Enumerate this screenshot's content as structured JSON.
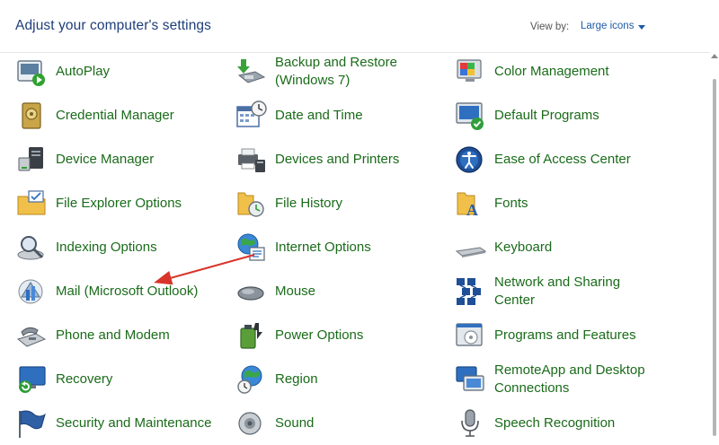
{
  "header": {
    "title": "Adjust your computer's settings",
    "view_by_label": "View by:",
    "view_by_value": "Large icons"
  },
  "colors": {
    "link_green": "#1a6b1a",
    "title_blue": "#1e3e7a",
    "accent_blue": "#1e5aa8",
    "annotation_red": "#d9342b"
  },
  "items": [
    {
      "label": "AutoPlay",
      "icon": "autoplay-icon"
    },
    {
      "label": "Backup and Restore\n(Windows 7)",
      "icon": "backup-restore-icon"
    },
    {
      "label": "Color Management",
      "icon": "color-management-icon"
    },
    {
      "label": "Credential Manager",
      "icon": "credential-manager-icon"
    },
    {
      "label": "Date and Time",
      "icon": "date-time-icon"
    },
    {
      "label": "Default Programs",
      "icon": "default-programs-icon"
    },
    {
      "label": "Device Manager",
      "icon": "device-manager-icon"
    },
    {
      "label": "Devices and Printers",
      "icon": "devices-printers-icon"
    },
    {
      "label": "Ease of Access Center",
      "icon": "ease-of-access-icon"
    },
    {
      "label": "File Explorer Options",
      "icon": "file-explorer-options-icon"
    },
    {
      "label": "File History",
      "icon": "file-history-icon"
    },
    {
      "label": "Fonts",
      "icon": "fonts-icon"
    },
    {
      "label": "Indexing Options",
      "icon": "indexing-options-icon"
    },
    {
      "label": "Internet Options",
      "icon": "internet-options-icon"
    },
    {
      "label": "Keyboard",
      "icon": "keyboard-icon"
    },
    {
      "label": "Mail (Microsoft Outlook)",
      "icon": "mail-icon"
    },
    {
      "label": "Mouse",
      "icon": "mouse-icon"
    },
    {
      "label": "Network and Sharing\nCenter",
      "icon": "network-sharing-icon"
    },
    {
      "label": "Phone and Modem",
      "icon": "phone-modem-icon"
    },
    {
      "label": "Power Options",
      "icon": "power-options-icon"
    },
    {
      "label": "Programs and Features",
      "icon": "programs-features-icon"
    },
    {
      "label": "Recovery",
      "icon": "recovery-icon"
    },
    {
      "label": "Region",
      "icon": "region-icon"
    },
    {
      "label": "RemoteApp and Desktop\nConnections",
      "icon": "remoteapp-icon"
    },
    {
      "label": "Security and Maintenance",
      "icon": "security-maintenance-icon"
    },
    {
      "label": "Sound",
      "icon": "sound-icon"
    },
    {
      "label": "Speech Recognition",
      "icon": "speech-recognition-icon"
    }
  ]
}
